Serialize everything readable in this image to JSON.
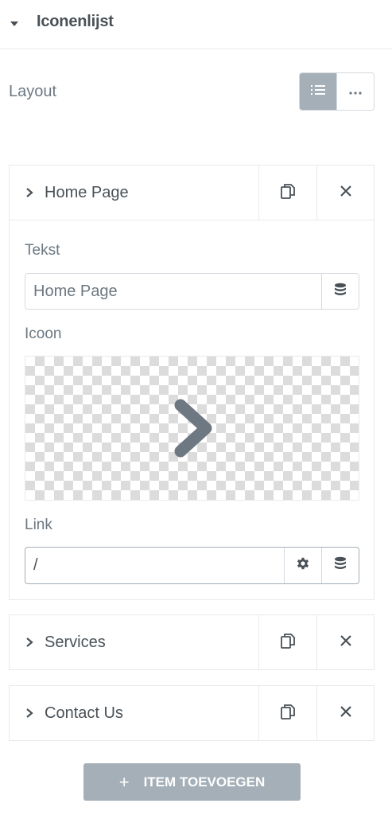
{
  "section": {
    "title": "Iconenlijst",
    "caret_icon": "caret-down-icon"
  },
  "layout": {
    "label": "Layout",
    "options": [
      {
        "icon": "list-icon",
        "active": true
      },
      {
        "icon": "ellipsis-icon",
        "active": false
      }
    ]
  },
  "items": [
    {
      "title": "Home Page",
      "expanded": true,
      "fields": {
        "text_label": "Tekst",
        "text_value": "Home Page",
        "icon_label": "Icoon",
        "icon_value": "chevron-right-icon",
        "link_label": "Link",
        "link_value": "/"
      }
    },
    {
      "title": "Services",
      "expanded": false
    },
    {
      "title": "Contact Us",
      "expanded": false
    }
  ],
  "add_button": {
    "label": "ITEM TOEVOEGEN",
    "icon": "plus-icon"
  },
  "colors": {
    "text": "#495157",
    "muted": "#6d7882",
    "button": "#a4afb7",
    "border": "#e6e9ec"
  }
}
